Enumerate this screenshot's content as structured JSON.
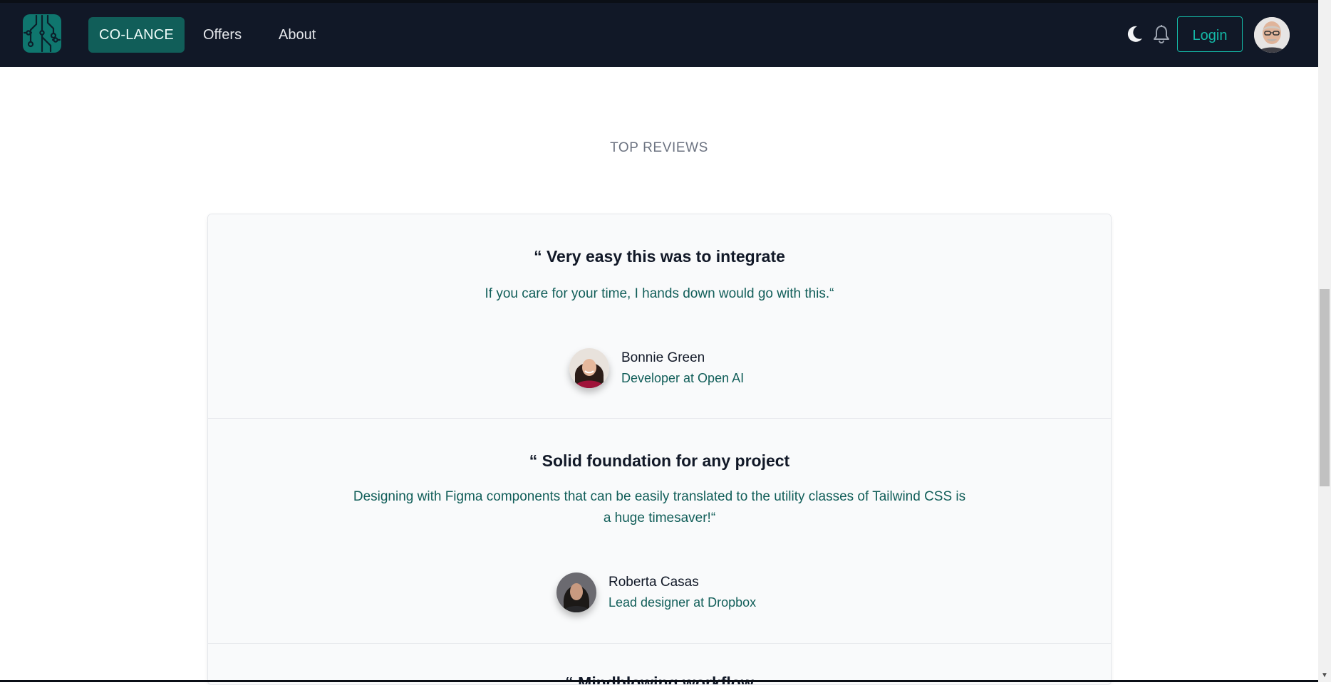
{
  "header": {
    "logo_icon": "circuit-logo-icon",
    "brand_label": "CO-LANCE",
    "nav_items": [
      {
        "label": "Offers"
      },
      {
        "label": "About"
      }
    ],
    "theme_icon": "moon-icon",
    "notifications_icon": "bell-icon",
    "login_label": "Login",
    "avatar_icon": "user-avatar"
  },
  "reviews_section": {
    "title": "TOP REVIEWS",
    "items": [
      {
        "heading": "“ Very easy this was to integrate",
        "text": "If you care for your time, I hands down would go with this.“",
        "author": "Bonnie Green",
        "role": "Developer at Open AI"
      },
      {
        "heading": "“ Solid foundation for any project",
        "text": "Designing with Figma components that can be easily translated to the utility classes of Tailwind CSS is a huge timesaver!“",
        "author": "Roberta Casas",
        "role": "Lead designer at Dropbox"
      },
      {
        "heading": "“ Mindblowing workflow"
      }
    ]
  },
  "colors": {
    "navbar_bg": "#111827",
    "brand_bg": "#115e59",
    "accent": "#14b8a6",
    "review_text": "#115e59"
  }
}
